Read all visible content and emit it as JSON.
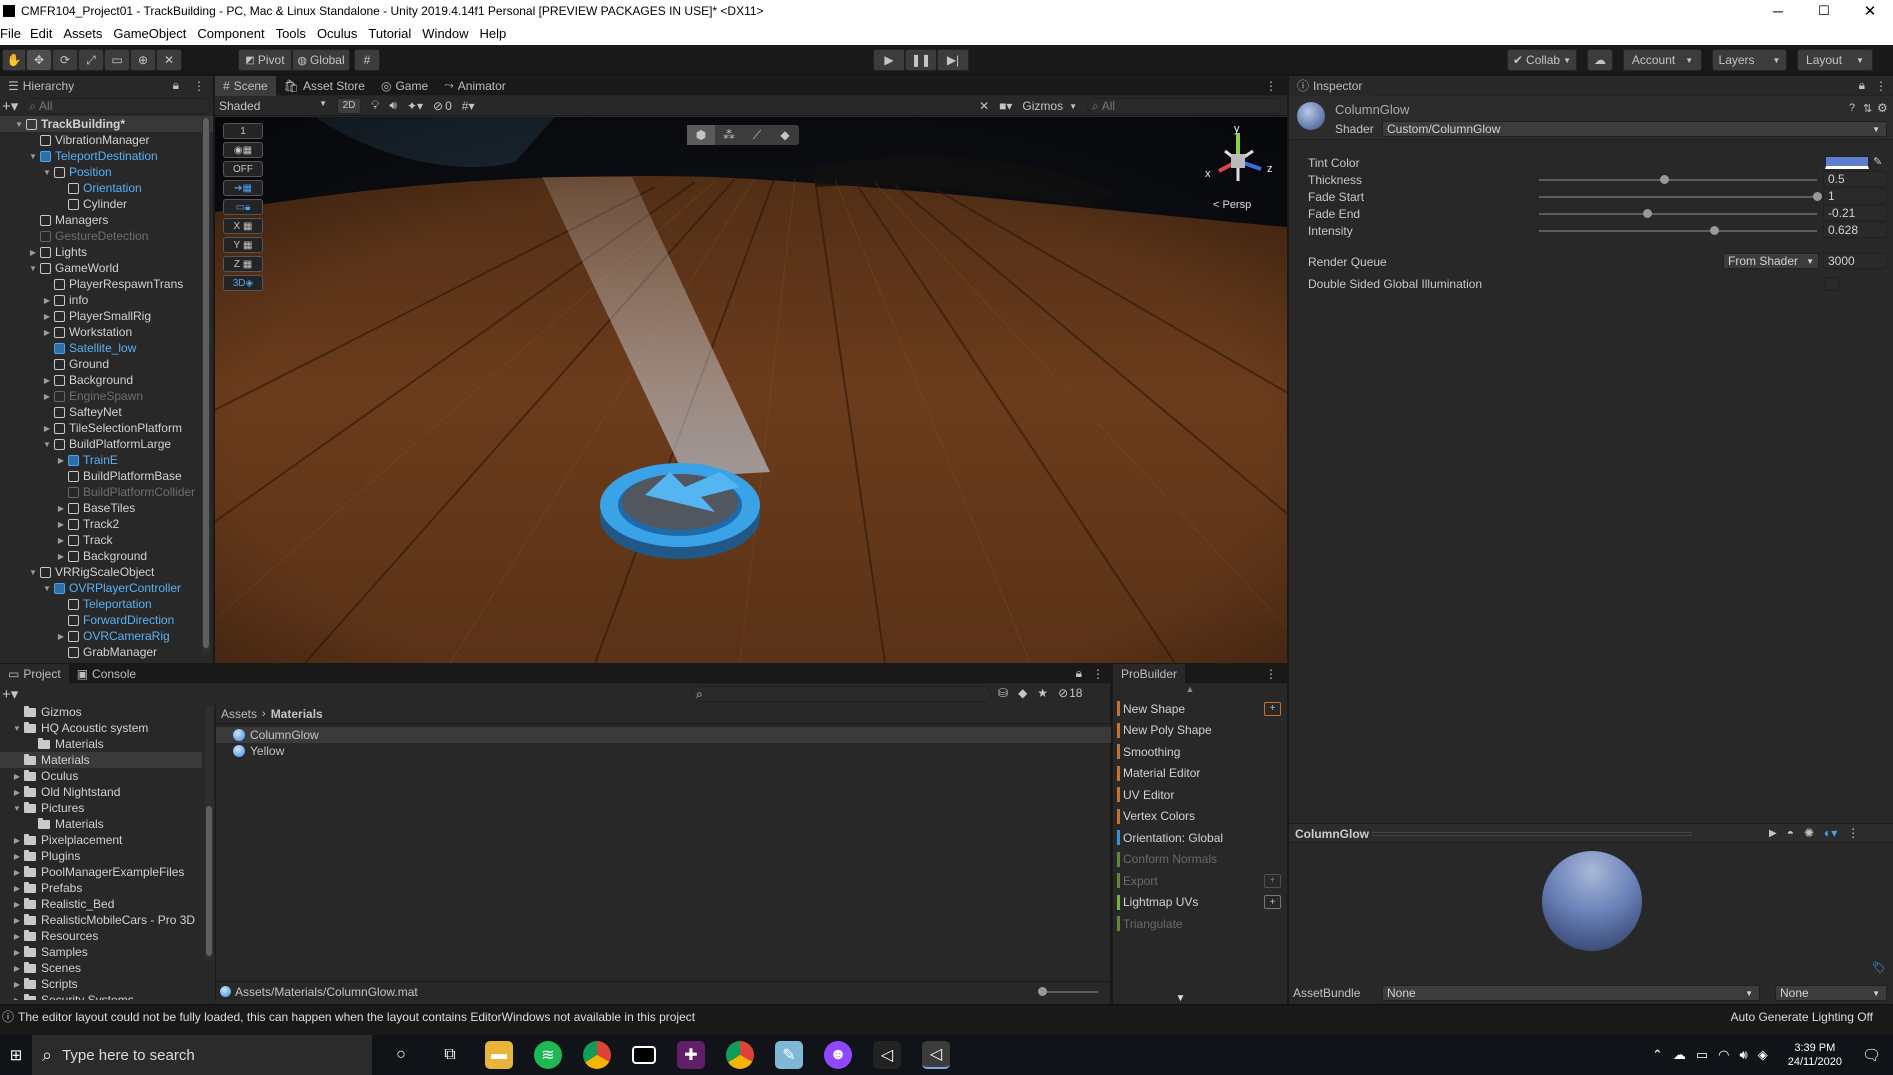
{
  "window": {
    "title": "CMFR104_Project01 - TrackBuilding - PC, Mac & Linux Standalone - Unity 2019.4.14f1 Personal [PREVIEW PACKAGES IN USE]* <DX11>"
  },
  "menu": [
    "File",
    "Edit",
    "Assets",
    "GameObject",
    "Component",
    "Tools",
    "Oculus",
    "Tutorial",
    "Window",
    "Help"
  ],
  "toolbar": {
    "pivot": "Pivot",
    "global": "Global",
    "collab": "Collab",
    "account": "Account",
    "layers": "Layers",
    "layout": "Layout"
  },
  "hierarchy": {
    "tab": "Hierarchy",
    "search_placeholder": "All",
    "rows": [
      {
        "label": "TrackBuilding*",
        "depth": 0,
        "expand": "open",
        "style": "scene"
      },
      {
        "label": "VibrationManager",
        "depth": 1,
        "expand": "",
        "style": "normal"
      },
      {
        "label": "TeleportDestination",
        "depth": 1,
        "expand": "open",
        "style": "prefab",
        "arrow": true
      },
      {
        "label": "Position",
        "depth": 2,
        "expand": "open",
        "style": "prefab-child"
      },
      {
        "label": "Orientation",
        "depth": 3,
        "expand": "",
        "style": "prefab-child"
      },
      {
        "label": "Cylinder",
        "depth": 3,
        "expand": "",
        "style": "normal"
      },
      {
        "label": "Managers",
        "depth": 1,
        "expand": "",
        "style": "normal"
      },
      {
        "label": "GestureDetection",
        "depth": 1,
        "expand": "",
        "style": "disabled"
      },
      {
        "label": "Lights",
        "depth": 1,
        "expand": "closed",
        "style": "normal"
      },
      {
        "label": "GameWorld",
        "depth": 1,
        "expand": "open",
        "style": "normal"
      },
      {
        "label": "PlayerRespawnTrans",
        "depth": 2,
        "expand": "",
        "style": "normal"
      },
      {
        "label": "info",
        "depth": 2,
        "expand": "closed",
        "style": "normal"
      },
      {
        "label": "PlayerSmallRig",
        "depth": 2,
        "expand": "closed",
        "style": "normal"
      },
      {
        "label": "Workstation",
        "depth": 2,
        "expand": "closed",
        "style": "normal"
      },
      {
        "label": "Satellite_low",
        "depth": 2,
        "expand": "",
        "style": "prefab"
      },
      {
        "label": "Ground",
        "depth": 2,
        "expand": "",
        "style": "normal"
      },
      {
        "label": "Background",
        "depth": 2,
        "expand": "closed",
        "style": "normal"
      },
      {
        "label": "EngineSpawn",
        "depth": 2,
        "expand": "closed",
        "style": "disabled"
      },
      {
        "label": "SafteyNet",
        "depth": 2,
        "expand": "",
        "style": "normal"
      },
      {
        "label": "TileSelectionPlatform",
        "depth": 2,
        "expand": "closed",
        "style": "normal"
      },
      {
        "label": "BuildPlatformLarge",
        "depth": 2,
        "expand": "open",
        "style": "normal"
      },
      {
        "label": "TrainE",
        "depth": 3,
        "expand": "closed",
        "style": "prefab",
        "arrow": true
      },
      {
        "label": "BuildPlatformBase",
        "depth": 3,
        "expand": "",
        "style": "normal"
      },
      {
        "label": "BuildPlatformCollider",
        "depth": 3,
        "expand": "",
        "style": "disabled"
      },
      {
        "label": "BaseTiles",
        "depth": 3,
        "expand": "closed",
        "style": "normal"
      },
      {
        "label": "Track2",
        "depth": 3,
        "expand": "closed",
        "style": "normal"
      },
      {
        "label": "Track",
        "depth": 3,
        "expand": "closed",
        "style": "normal"
      },
      {
        "label": "Background",
        "depth": 3,
        "expand": "closed",
        "style": "normal"
      },
      {
        "label": "VRRigScaleObject",
        "depth": 1,
        "expand": "open",
        "style": "normal"
      },
      {
        "label": "OVRPlayerController",
        "depth": 2,
        "expand": "open",
        "style": "prefab",
        "arrow": true
      },
      {
        "label": "Teleportation",
        "depth": 3,
        "expand": "",
        "style": "prefab-child"
      },
      {
        "label": "ForwardDirection",
        "depth": 3,
        "expand": "",
        "style": "prefab-child"
      },
      {
        "label": "OVRCameraRig",
        "depth": 3,
        "expand": "closed",
        "style": "prefab-child"
      },
      {
        "label": "GrabManager",
        "depth": 3,
        "expand": "",
        "style": "normal"
      }
    ]
  },
  "scene": {
    "tabs": [
      "Scene",
      "Asset Store",
      "Game",
      "Animator"
    ],
    "shading": "Shaded",
    "mode_2d": "2D",
    "hidden_count": "0",
    "gizmos": "Gizmos",
    "search_placeholder": "All",
    "persp": "< Persp",
    "left_tools": [
      "1",
      "",
      "OFF",
      "",
      "",
      "X",
      "Y",
      "Z",
      "3D"
    ],
    "axis": {
      "x": "x",
      "y": "y",
      "z": "z"
    }
  },
  "inspector": {
    "tab": "Inspector",
    "material_name": "ColumnGlow",
    "shader_label": "Shader",
    "shader_value": "Custom/ColumnGlow",
    "tint_label": "Tint Color",
    "tint_color": "#5e7fcf",
    "properties": [
      {
        "label": "Thickness",
        "value": "0.5",
        "fill": 0.45
      },
      {
        "label": "Fade Start",
        "value": "1",
        "fill": 1.0
      },
      {
        "label": "Fade End",
        "value": "-0.21",
        "fill": 0.39
      },
      {
        "label": "Intensity",
        "value": "0.628",
        "fill": 0.63
      }
    ],
    "render_queue_label": "Render Queue",
    "render_queue_mode": "From Shader",
    "render_queue_value": "3000",
    "dsgi_label": "Double Sided Global Illumination",
    "preview_title": "ColumnGlow",
    "assetbundle_label": "AssetBundle",
    "assetbundle_value": "None",
    "assetbundle_variant": "None"
  },
  "project": {
    "tabs": [
      "Project",
      "Console"
    ],
    "hidden_count": "18",
    "breadcrumb_root": "Assets",
    "breadcrumb_current": "Materials",
    "tree": [
      {
        "label": "Gizmos",
        "depth": 0,
        "expand": ""
      },
      {
        "label": "HQ Acoustic system",
        "depth": 0,
        "expand": "open"
      },
      {
        "label": "Materials",
        "depth": 1,
        "expand": ""
      },
      {
        "label": "Materials",
        "depth": 0,
        "expand": "",
        "selected": true
      },
      {
        "label": "Oculus",
        "depth": 0,
        "expand": "closed"
      },
      {
        "label": "Old Nightstand",
        "depth": 0,
        "expand": "closed"
      },
      {
        "label": "Pictures",
        "depth": 0,
        "expand": "open"
      },
      {
        "label": "Materials",
        "depth": 1,
        "expand": ""
      },
      {
        "label": "Pixelplacement",
        "depth": 0,
        "expand": "closed"
      },
      {
        "label": "Plugins",
        "depth": 0,
        "expand": "closed"
      },
      {
        "label": "PoolManagerExampleFiles",
        "depth": 0,
        "expand": "closed"
      },
      {
        "label": "Prefabs",
        "depth": 0,
        "expand": "closed"
      },
      {
        "label": "Realistic_Bed",
        "depth": 0,
        "expand": "closed"
      },
      {
        "label": "RealisticMobileCars - Pro 3D",
        "depth": 0,
        "expand": "closed"
      },
      {
        "label": "Resources",
        "depth": 0,
        "expand": "closed"
      },
      {
        "label": "Samples",
        "depth": 0,
        "expand": "closed"
      },
      {
        "label": "Scenes",
        "depth": 0,
        "expand": "closed"
      },
      {
        "label": "Scripts",
        "depth": 0,
        "expand": "closed"
      },
      {
        "label": "Security Systems",
        "depth": 0,
        "expand": "closed"
      }
    ],
    "files": [
      "ColumnGlow",
      "Yellow"
    ],
    "footer_path": "Assets/Materials/ColumnGlow.mat"
  },
  "probuilder": {
    "tab": "ProBuilder",
    "items": [
      {
        "label": "New Shape",
        "color": "#c7712e",
        "plus": true,
        "enabled": true
      },
      {
        "label": "New Poly Shape",
        "color": "#c7712e",
        "plus": false,
        "enabled": true
      },
      {
        "label": "Smoothing",
        "color": "#c7712e",
        "plus": false,
        "enabled": true
      },
      {
        "label": "Material Editor",
        "color": "#c7712e",
        "plus": false,
        "enabled": true
      },
      {
        "label": "UV Editor",
        "color": "#c7712e",
        "plus": false,
        "enabled": true
      },
      {
        "label": "Vertex Colors",
        "color": "#c7712e",
        "plus": false,
        "enabled": true
      },
      {
        "label": "Orientation: Global",
        "color": "#3a8fd6",
        "plus": false,
        "enabled": true
      },
      {
        "label": "Conform Normals",
        "color": "#5d8a3a",
        "plus": false,
        "enabled": false
      },
      {
        "label": "Export",
        "color": "#5d8a3a",
        "plus": true,
        "enabled": false
      },
      {
        "label": "Lightmap UVs",
        "color": "#6cb83e",
        "plus": true,
        "enabled": true
      },
      {
        "label": "Triangulate",
        "color": "#5d8a3a",
        "plus": false,
        "enabled": false
      }
    ]
  },
  "statusbar": {
    "message": "The editor layout could not be fully loaded, this can happen when the layout contains EditorWindows not available in this project",
    "right": "Auto Generate Lighting Off"
  },
  "taskbar": {
    "search_placeholder": "Type here to search",
    "time": "3:39 PM",
    "date": "24/11/2020"
  }
}
